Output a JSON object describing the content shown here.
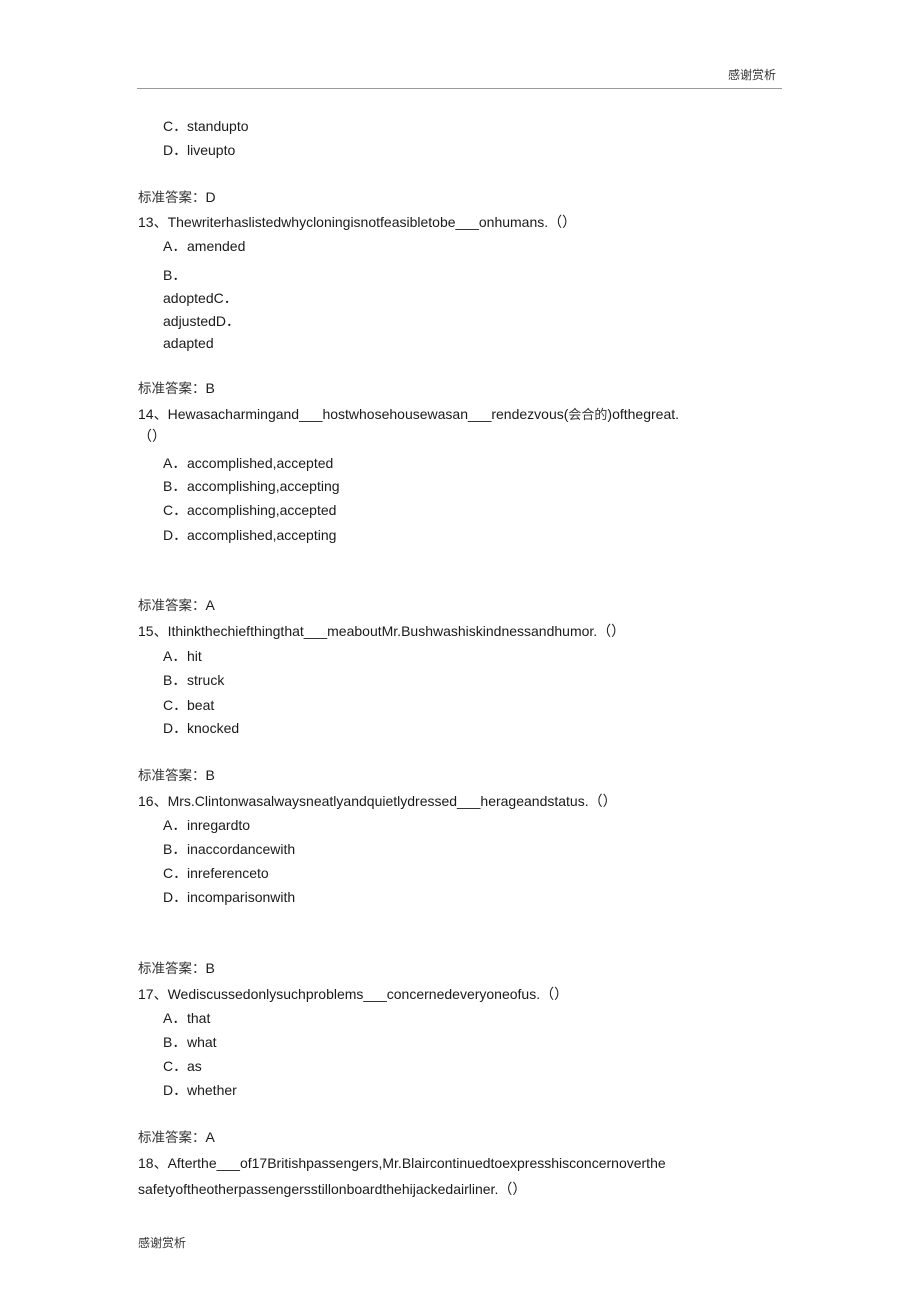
{
  "header": {
    "text": "感谢赏析"
  },
  "footer": {
    "text": "感谢赏析"
  },
  "answer_label": "标准答案：",
  "q12_tail": {
    "options": [
      {
        "letter": "C．",
        "text": "standupto"
      },
      {
        "letter": "D．",
        "text": "liveupto"
      }
    ],
    "answer": "D"
  },
  "q13": {
    "number": "13、",
    "stem": "Thewriterhaslistedwhycloningisnotfeasibletobe___onhumans.（）",
    "option_a": {
      "letter": "A．",
      "text": "amended"
    },
    "broken_lines": [
      "B．",
      "adoptedC．",
      "adjustedD．",
      "adapted"
    ],
    "answer": "B"
  },
  "q14": {
    "number": "14、",
    "stem_pre": "Hewasacharmingand___hostwhosehousewasan___rendezvous(",
    "stem_cn": "会合的",
    "stem_post": ")ofthegreat.",
    "stem_line2": "（）",
    "options": [
      {
        "letter": "A．",
        "text": "accomplished,accepted"
      },
      {
        "letter": "B．",
        "text": "accomplishing,accepting"
      },
      {
        "letter": "C．",
        "text": "accomplishing,accepted"
      },
      {
        "letter": "D．",
        "text": "accomplished,accepting"
      }
    ],
    "answer": "A"
  },
  "q15": {
    "number": "15、",
    "stem": "Ithinkthechiefthingthat___meaboutMr.Bushwashiskindnessandhumor.（）",
    "options": [
      {
        "letter": "A．",
        "text": "hit"
      },
      {
        "letter": "B．",
        "text": "struck"
      },
      {
        "letter": "C．",
        "text": "beat"
      },
      {
        "letter": "D．",
        "text": "knocked"
      }
    ],
    "answer": "B"
  },
  "q16": {
    "number": "16、",
    "stem": "Mrs.Clintonwasalwaysneatlyandquietlydressed___herageandstatus.（）",
    "options": [
      {
        "letter": "A．",
        "text": "inregardto"
      },
      {
        "letter": "B．",
        "text": "inaccordancewith"
      },
      {
        "letter": "C．",
        "text": "inreferenceto"
      },
      {
        "letter": "D．",
        "text": "incomparisonwith"
      }
    ],
    "answer": "B"
  },
  "q17": {
    "number": "17、",
    "stem": "Wediscussedonlysuchproblems___concernedeveryoneofus.（）",
    "options": [
      {
        "letter": "A．",
        "text": "that"
      },
      {
        "letter": "B．",
        "text": "what"
      },
      {
        "letter": "C．",
        "text": "as"
      },
      {
        "letter": "D．",
        "text": "whether"
      }
    ],
    "answer": "A"
  },
  "q18": {
    "number": "18、",
    "stem_line1": "Afterthe___of17Britishpassengers,Mr.Blaircontinuedtoexpresshisconcernoverthe",
    "stem_line2": "safetyoftheotherpassengersstillonboardthehijackedairliner.（）"
  }
}
